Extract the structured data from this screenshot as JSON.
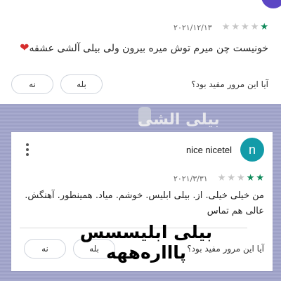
{
  "top_review": {
    "date": "۲۰۲۱/۱۲/۱۳",
    "rating": 1,
    "max_rating": 5,
    "text": "خونیست چن میرم توش میره بیرون ولی بیلی آلشی عشقه",
    "heart": "❤",
    "helpful_question": "آیا این مرور مفید بود؟",
    "yes_label": "بله",
    "no_label": "نه"
  },
  "background": {
    "overlay_text": "بیلی الشی"
  },
  "main_review": {
    "reviewer_name": "nice nicetel",
    "avatar_letter": "n",
    "avatar_color": "#139ba8",
    "date": "۲۰۲۱/۳/۳۱",
    "rating": 2,
    "max_rating": 5,
    "text": "من خیلی خیلی. از. بیلی ابلیس. خوشم. میاد. همینطور. آهنگش. عالی هم تماس",
    "helpful_question": "آیا این مرور مفید بود؟"
  },
  "overlay_caption": "بیلی ابلیسسس پاااره‌ههه",
  "colors": {
    "star_on": "#0f8a5a",
    "star_off": "#c7c7c7",
    "band": "#a9acd0"
  }
}
